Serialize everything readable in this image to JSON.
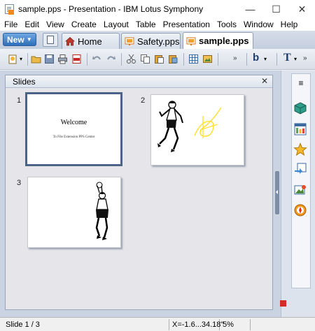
{
  "window": {
    "title": "sample.pps - Presentation - IBM Lotus Symphony",
    "minimize": "—",
    "maximize": "☐",
    "close": "✕"
  },
  "menu": [
    "File",
    "Edit",
    "View",
    "Create",
    "Layout",
    "Table",
    "Presentation",
    "Tools",
    "Window",
    "Help"
  ],
  "tabs": {
    "new_label": "New",
    "new_arrow": "▼",
    "items": [
      {
        "label": "Home",
        "icon": "home-icon"
      },
      {
        "label": "Safety.pps",
        "icon": "presentation-icon"
      },
      {
        "label": "sample.pps",
        "icon": "presentation-icon",
        "active": true
      }
    ]
  },
  "toolbar": {
    "font_dropdown": "▾",
    "bold": "b",
    "text": "T",
    "chevron": "»"
  },
  "slides_panel": {
    "title": "Slides",
    "close": "✕",
    "slides": [
      {
        "number": "1",
        "title": "Welcome",
        "subtitle": "To File Extension PPS Center",
        "selected": true
      },
      {
        "number": "2",
        "image": "runner-with-signature"
      },
      {
        "number": "3",
        "image": "basketball-player"
      }
    ]
  },
  "sidebar": {
    "menu_icon": "≡"
  },
  "status": {
    "slide": "Slide 1 / 3",
    "coords": "X=-1.6...34.18\"",
    "zoom": "5%"
  },
  "colors": {
    "accent": "#2f6fb9",
    "tab_bar": "#c4cedd",
    "workspace": "#c9d3e1",
    "selected_border": "#4b6485"
  }
}
